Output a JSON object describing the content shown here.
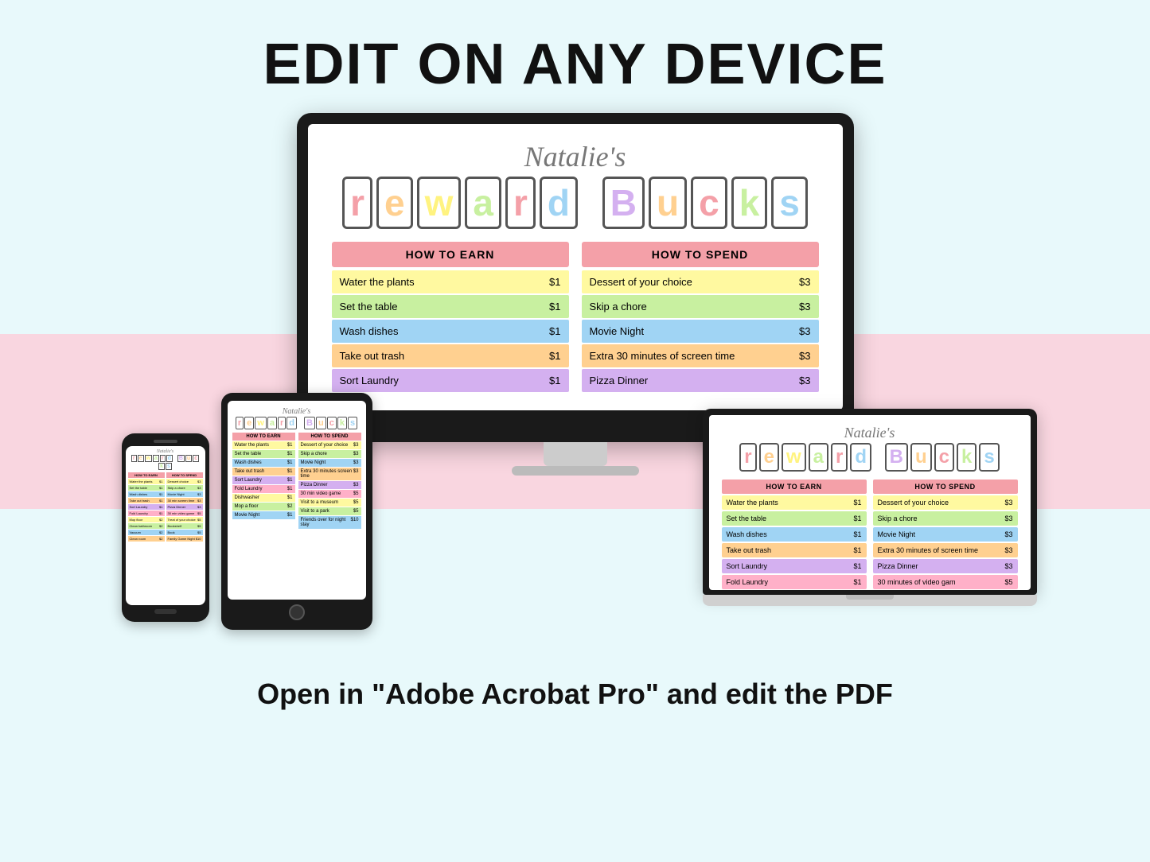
{
  "page": {
    "bg_color": "#e8f9fb",
    "pink_band_color": "#f9d6e0",
    "main_title": "EDIT ON ANY DEVICE",
    "bottom_text": "Open in \"Adobe Acrobat Pro\" and edit the PDF"
  },
  "monitor": {
    "natalies_text": "Natalie's",
    "reward_bucks_letters": [
      "r",
      "e",
      "w",
      "a",
      "r",
      "d",
      "B",
      "u",
      "c",
      "k",
      "s"
    ],
    "reward_bucks_colors": [
      "#f4a0a8",
      "#ffd090",
      "#fff380",
      "#c8f0a0",
      "#f4a0a8",
      "#a0d4f4",
      "#d4b0f0",
      "#ffd090",
      "#f4a0a8",
      "#c8f0a0",
      "#a0d4f4"
    ],
    "earn_header": "HOW TO EARN",
    "spend_header": "HOW TO SPEND",
    "earn_rows": [
      {
        "task": "Water the plants",
        "amount": "$1",
        "color": "row-yellow"
      },
      {
        "task": "Set the table",
        "amount": "$1",
        "color": "row-green"
      },
      {
        "task": "Wash dishes",
        "amount": "$1",
        "color": "row-blue"
      },
      {
        "task": "Take out trash",
        "amount": "$1",
        "color": "row-orange"
      },
      {
        "task": "Sort Laundry",
        "amount": "$1",
        "color": "row-purple"
      }
    ],
    "spend_rows": [
      {
        "task": "Dessert of your choice",
        "amount": "$3",
        "color": "row-yellow"
      },
      {
        "task": "Skip a chore",
        "amount": "$3",
        "color": "row-green"
      },
      {
        "task": "Movie Night",
        "amount": "$3",
        "color": "row-blue"
      },
      {
        "task": "Extra 30 minutes of screen time",
        "amount": "$3",
        "color": "row-orange"
      },
      {
        "task": "Pizza Dinner",
        "amount": "$3",
        "color": "row-purple"
      }
    ]
  },
  "laptop": {
    "natalies_text": "Natalie's",
    "earn_header": "HOW TO EARN",
    "spend_header": "HOW TO SPEND",
    "earn_rows": [
      {
        "task": "Water the plants",
        "amount": "$1",
        "color": "row-yellow"
      },
      {
        "task": "Set the table",
        "amount": "$1",
        "color": "row-green"
      },
      {
        "task": "Wash dishes",
        "amount": "$1",
        "color": "row-blue"
      },
      {
        "task": "Take out trash",
        "amount": "$1",
        "color": "row-orange"
      },
      {
        "task": "Sort Laundry",
        "amount": "$1",
        "color": "row-purple"
      },
      {
        "task": "Fold Laundry",
        "amount": "$1",
        "color": "row-pink"
      }
    ],
    "spend_rows": [
      {
        "task": "Dessert of your choice",
        "amount": "$3",
        "color": "row-yellow"
      },
      {
        "task": "Skip a chore",
        "amount": "$3",
        "color": "row-green"
      },
      {
        "task": "Movie Night",
        "amount": "$3",
        "color": "row-blue"
      },
      {
        "task": "Extra 30 minutes of screen time",
        "amount": "$3",
        "color": "row-orange"
      },
      {
        "task": "Pizza Dinner",
        "amount": "$3",
        "color": "row-purple"
      },
      {
        "task": "30 minutes of video gam",
        "amount": "$5",
        "color": "row-pink"
      }
    ]
  },
  "icons": {
    "pencil": "✏️"
  }
}
